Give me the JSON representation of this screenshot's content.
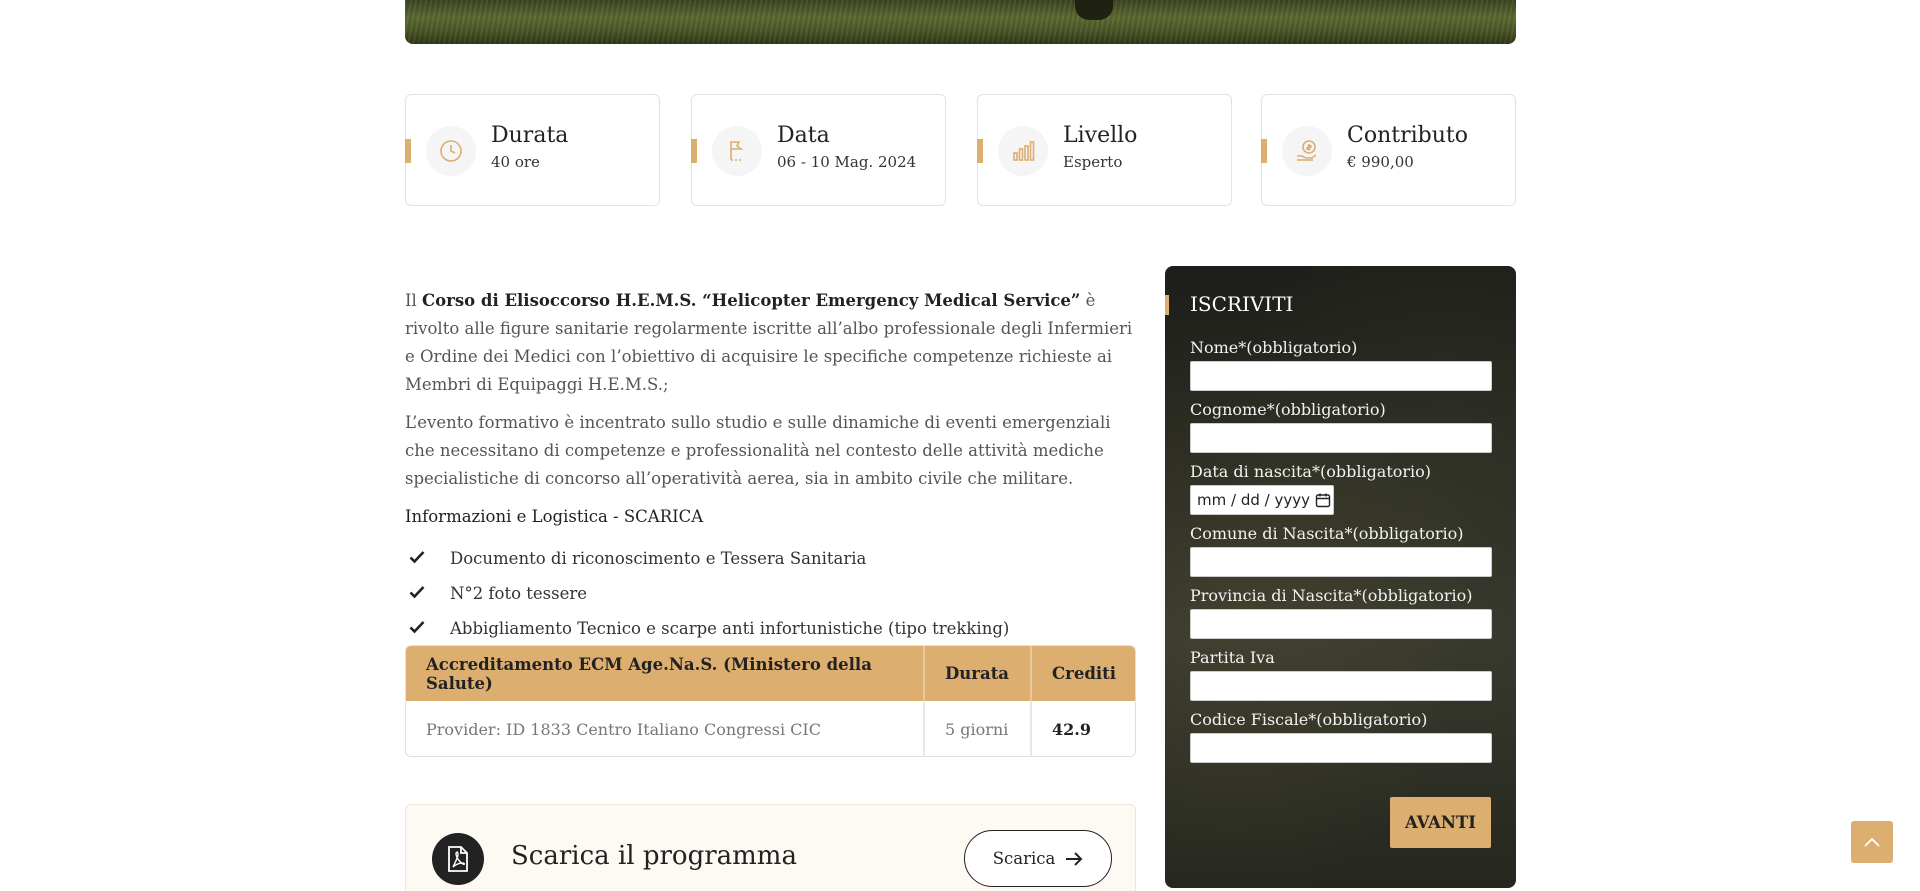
{
  "stats": [
    {
      "title": "Durata",
      "value": "40 ore",
      "icon": "clock-icon"
    },
    {
      "title": "Data",
      "value": "06 - 10 Mag. 2024",
      "icon": "flag-icon"
    },
    {
      "title": "Livello",
      "value": "Esperto",
      "icon": "level-bars-icon"
    },
    {
      "title": "Contributo",
      "value": "€ 990,00",
      "icon": "coin-hand-icon"
    }
  ],
  "description": {
    "p1_prefix": "Il ",
    "p1_bold": "Corso di Elisoccorso H.E.M.S. “Helicopter Emergency Medical Service”",
    "p1_suffix": " è rivolto alle figure sanitarie regolarmente iscritte all’albo professionale degli Infermieri e Ordine dei Medici con l’obiettivo di acquisire le specifiche competenze richieste ai Membri di Equipaggi H.E.M.S.;",
    "p2": "L’evento formativo è incentrato sullo studio e sulle dinamiche di eventi emergenziali che necessitano di competenze e professionalità nel contesto delle attività mediche specialistiche di concorso all’operatività aerea, sia in ambito civile che militare."
  },
  "info_title": "Informazioni e Logistica - SCARICA",
  "checklist": [
    "Documento di riconoscimento e Tessera Sanitaria",
    "N°2 foto tessere",
    "Abbigliamento Tecnico e scarpe anti infortunistiche (tipo trekking)"
  ],
  "ecm_table": {
    "headers": [
      "Accreditamento ECM Age.Na.S. (Ministero della Salute)",
      "Durata",
      "Crediti"
    ],
    "row": [
      "Provider: ID 1833 Centro Italiano Congressi CIC",
      "5 giorni",
      "42.9"
    ]
  },
  "download": {
    "label": "Scarica il programma",
    "button": "Scarica"
  },
  "form": {
    "title": "ISCRIVITI",
    "fields": [
      {
        "label": "Nome*(obbligatorio)",
        "type": "text"
      },
      {
        "label": "Cognome*(obbligatorio)",
        "type": "text"
      },
      {
        "label": "Data di nascita*(obbligatorio)",
        "type": "date",
        "placeholder": "mm / dd / yyyy"
      },
      {
        "label": "Comune di Nascita*(obbligatorio)",
        "type": "text"
      },
      {
        "label": "Provincia di Nascita*(obbligatorio)",
        "type": "text"
      },
      {
        "label": "Partita Iva",
        "type": "text"
      },
      {
        "label": "Codice Fiscale*(obbligatorio)",
        "type": "text"
      }
    ],
    "submit": "AVANTI"
  },
  "colors": {
    "accent": "#dcae70",
    "panel": "#26271f"
  }
}
